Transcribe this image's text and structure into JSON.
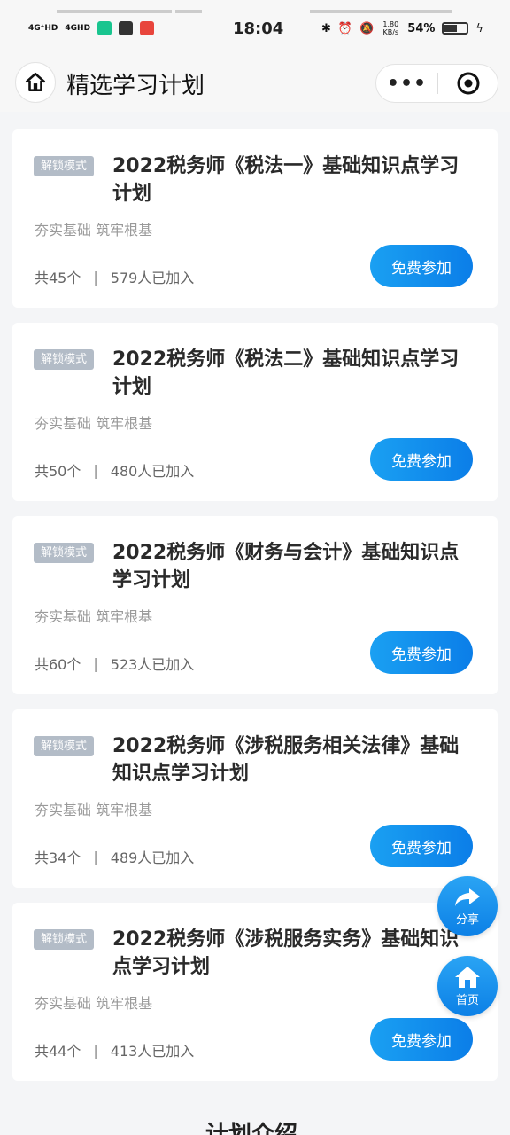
{
  "status_bar": {
    "signal1": "4G⁺HD",
    "signal2": "4GHD",
    "time": "18:04",
    "net_speed": "1.80 KB/s",
    "battery": "54%"
  },
  "header": {
    "title": "精选学习计划",
    "more_label": "•••"
  },
  "cards": [
    {
      "badge": "解锁模式",
      "title": "2022税务师《税法一》基础知识点学习计划",
      "subtitle": "夯实基础 筑牢根基",
      "count": "共45个",
      "joined": "579人已加入",
      "button": "免费参加"
    },
    {
      "badge": "解锁模式",
      "title": "2022税务师《税法二》基础知识点学习计划",
      "subtitle": "夯实基础 筑牢根基",
      "count": "共50个",
      "joined": "480人已加入",
      "button": "免费参加"
    },
    {
      "badge": "解锁模式",
      "title": "2022税务师《财务与会计》基础知识点学习计划",
      "subtitle": "夯实基础 筑牢根基",
      "count": "共60个",
      "joined": "523人已加入",
      "button": "免费参加"
    },
    {
      "badge": "解锁模式",
      "title": "2022税务师《涉税服务相关法律》基础知识点学习计划",
      "subtitle": "夯实基础 筑牢根基",
      "count": "共34个",
      "joined": "489人已加入",
      "button": "免费参加"
    },
    {
      "badge": "解锁模式",
      "title": "2022税务师《涉税服务实务》基础知识点学习计划",
      "subtitle": "夯实基础 筑牢根基",
      "count": "共44个",
      "joined": "413人已加入",
      "button": "免费参加"
    }
  ],
  "float": {
    "share_label": "分享",
    "home_label": "首页"
  },
  "bottom": {
    "heading": "计划介绍"
  },
  "colors": {
    "accent": "#0b7ee8",
    "badge": "#b3bcc7",
    "background": "#f4f5f7"
  }
}
